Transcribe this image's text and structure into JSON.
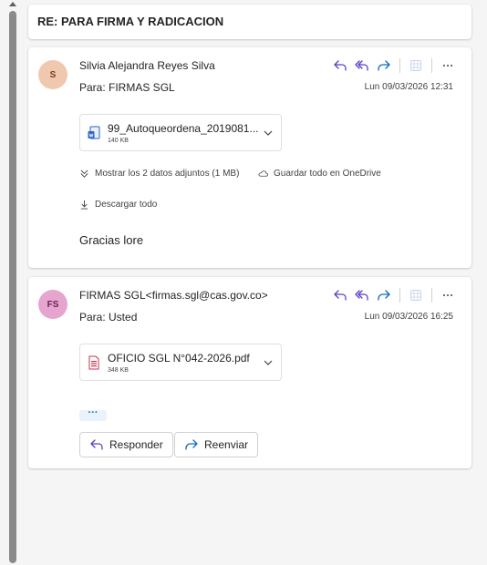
{
  "subject": "RE: PARA FIRMA Y RADICACION",
  "messages": [
    {
      "avatar_initials": "S",
      "avatar_bg": "#f0c8b0",
      "avatar_fg": "#7a3b16",
      "sender": "Silvia Alejandra Reyes Silva",
      "to": "Para:  FIRMAS SGL",
      "date": "Lun 09/03/2026 12:31",
      "attachment": {
        "name": "99_Autoqueordena_2019081...",
        "size": "140 KB",
        "icon": "word-doc-icon"
      },
      "show_more_attachments": "Mostrar los 2 datos adjuntos (1 MB)",
      "save_onedrive": "Guardar todo en OneDrive",
      "download_all": "Descargar todo",
      "body": "Gracias lore"
    },
    {
      "avatar_initials": "FS",
      "avatar_bg": "#e5a5cf",
      "avatar_fg": "#6b1f55",
      "sender": "FIRMAS SGL<firmas.sgl@cas.gov.co>",
      "to": "Para:  Usted",
      "date": "Lun 09/03/2026 16:25",
      "attachment": {
        "name": "OFICIO SGL N°042-2026.pdf",
        "size": "348 KB",
        "icon": "pdf-icon"
      },
      "ellipsis": "···",
      "reply_label": "Responder",
      "forward_label": "Reenviar"
    }
  ],
  "colors": {
    "accent": "#0f6cbd",
    "reply_icon": "#5b3ec8"
  }
}
